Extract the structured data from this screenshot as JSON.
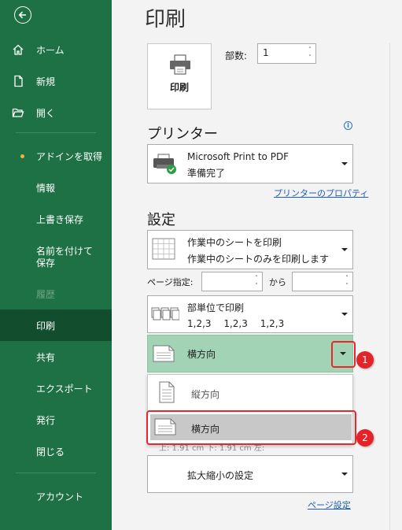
{
  "sidebar": {
    "items": [
      {
        "label": "ホーム",
        "icon": "home-icon"
      },
      {
        "label": "新規",
        "icon": "new-document-icon"
      },
      {
        "label": "開く",
        "icon": "folder-open-icon"
      },
      {
        "label": "アドインを取得"
      },
      {
        "label": "情報"
      },
      {
        "label": "上書き保存"
      },
      {
        "label": "名前を付けて保存"
      },
      {
        "label": "履歴"
      },
      {
        "label": "印刷"
      },
      {
        "label": "共有"
      },
      {
        "label": "エクスポート"
      },
      {
        "label": "発行"
      },
      {
        "label": "閉じる"
      },
      {
        "label": "アカウント"
      }
    ]
  },
  "main": {
    "title": "印刷",
    "print_button_label": "印刷",
    "copies_label": "部数:",
    "copies_value": "1",
    "printer_section_title": "プリンター",
    "printer": {
      "name": "Microsoft Print to PDF",
      "status": "準備完了"
    },
    "printer_properties_link": "プリンターのプロパティ",
    "settings_section_title": "設定",
    "print_what": {
      "line1": "作業中のシートを印刷",
      "line2": "作業中のシートのみを印刷します"
    },
    "pages_label": "ページ指定:",
    "pages_to_label": "から",
    "collate": {
      "line1": "部単位で印刷",
      "line2": "1,2,3　 1,2,3　 1,2,3"
    },
    "orientation_selected": "横方向",
    "orientation_options": [
      "縦方向",
      "横方向"
    ],
    "obscured_text": "上: 1.91 cm 下: 1.91 cm 左:",
    "scaling": "拡大縮小の設定",
    "page_setup_link": "ページ設定"
  },
  "callouts": {
    "badge1": "1",
    "badge2": "2"
  },
  "colors": {
    "sidebar_bg": "#1e7145",
    "active_bg": "#124e2d",
    "accent_green": "#a2d3b4",
    "callout_red": "#e52228",
    "link": "#1d5fb7"
  }
}
